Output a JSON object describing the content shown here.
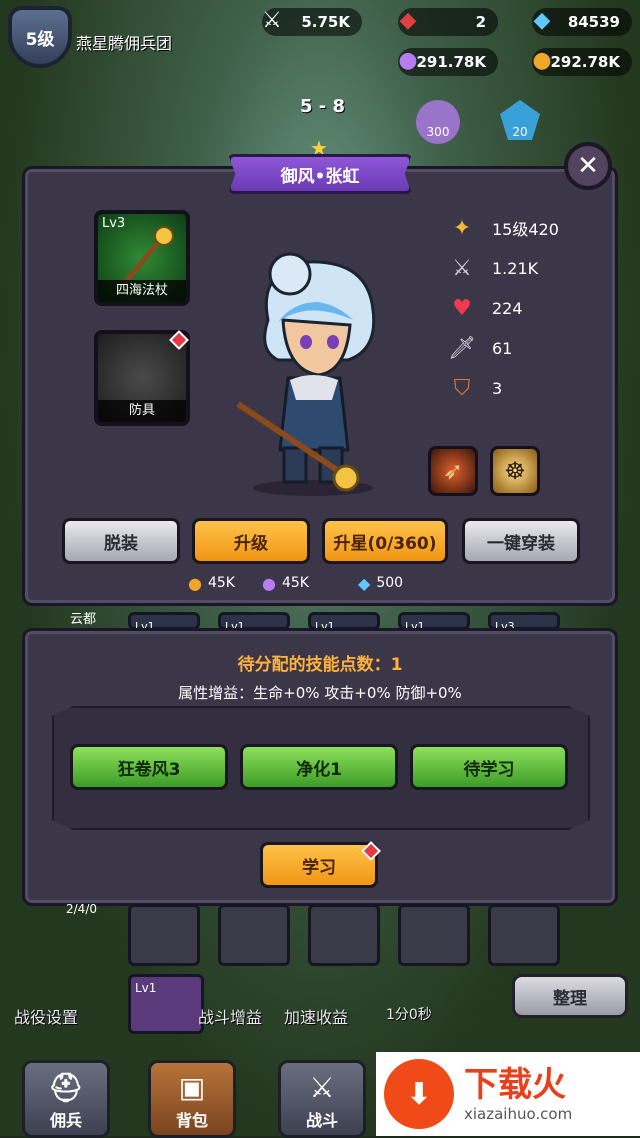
{
  "header": {
    "level": "5级",
    "guild": "燕星腾佣兵团",
    "resources": [
      {
        "icon": "crossed-swords-icon",
        "value": "5.75K"
      },
      {
        "icon": "red-gem-icon",
        "value": "2"
      },
      {
        "icon": "blue-diamond-icon",
        "value": "84539"
      },
      {
        "icon": "potion-icon",
        "value": "291.78K"
      },
      {
        "icon": "gold-coin-icon",
        "value": "292.78K"
      }
    ],
    "stage": "5 - 8",
    "bg_labels": [
      "300",
      "20"
    ]
  },
  "hero_panel": {
    "title": "御风•张虹",
    "weapon": {
      "level": "Lv3",
      "name": "四海法杖"
    },
    "armor": {
      "name": "防具"
    },
    "stats": [
      {
        "icon": "rank-icon",
        "value": "15级420"
      },
      {
        "icon": "power-icon",
        "value": "1.21K"
      },
      {
        "icon": "heart-icon",
        "value": "224"
      },
      {
        "icon": "sword-icon",
        "value": "61"
      },
      {
        "icon": "shield-icon",
        "value": "3"
      }
    ],
    "buttons": {
      "unequip": "脱装",
      "upgrade": "升级",
      "star_up": "升星(0/360)",
      "equip_all": "一键穿装"
    },
    "costs": [
      {
        "icon": "gold-coin-icon",
        "value": "45K"
      },
      {
        "icon": "potion-icon",
        "value": "45K"
      },
      {
        "icon": "blue-diamond-icon",
        "value": "500"
      }
    ]
  },
  "skill_panel": {
    "points": "待分配的技能点数：1",
    "bonus": "属性增益：生命+0% 攻击+0% 防御+0%",
    "skills": [
      "狂卷风3",
      "净化1",
      "待学习"
    ],
    "learn": "学习"
  },
  "background_ui": {
    "city": "云都",
    "card_levels": [
      "Lv1",
      "Lv1",
      "Lv1",
      "Lv1",
      "Lv3"
    ],
    "count": "2/4/0",
    "card_level_bottom": "Lv1",
    "arrange": "整理",
    "labels": [
      "战役设置",
      "战斗增益",
      "加速收益",
      "1分0秒"
    ],
    "nav": [
      "佣兵",
      "背包",
      "战斗"
    ]
  },
  "watermark": {
    "cn": "下载火",
    "en": "xiazaihuo.com"
  }
}
